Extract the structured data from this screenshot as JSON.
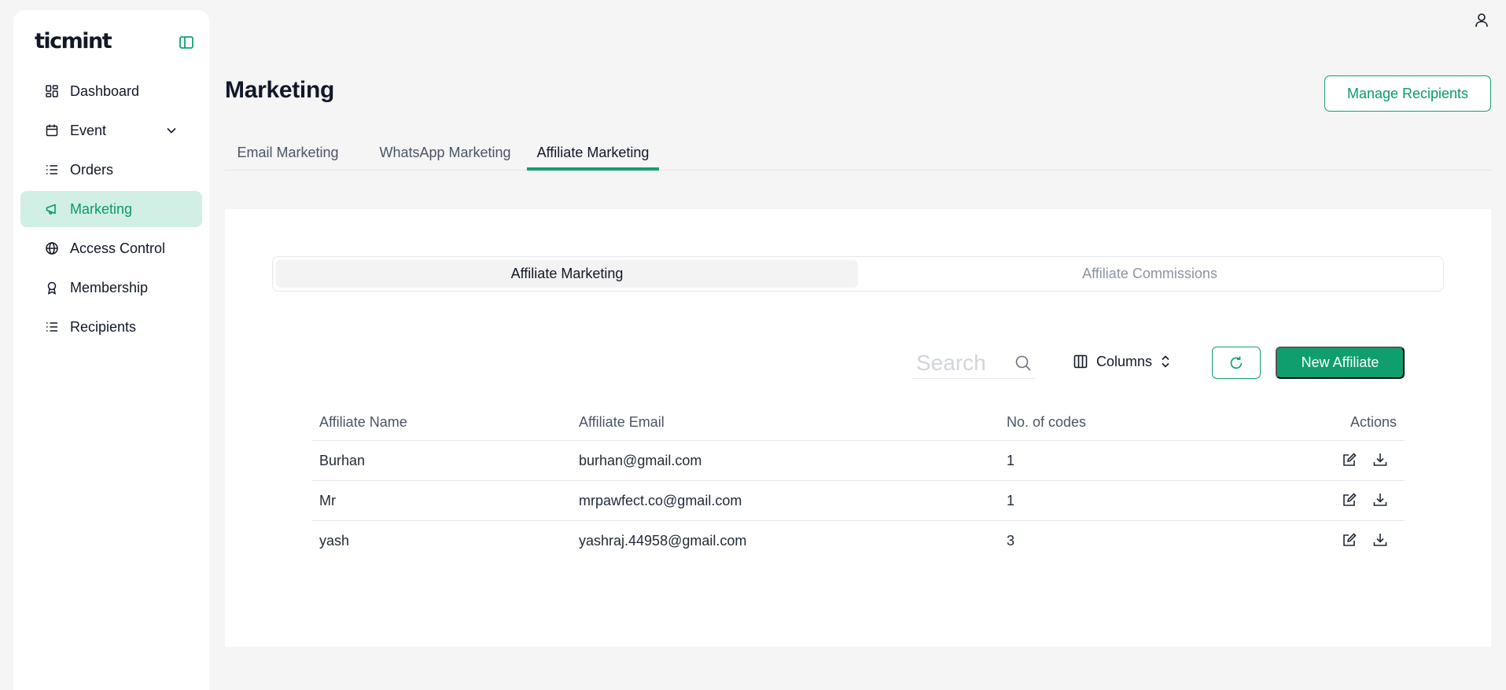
{
  "brand": {
    "name": "ticmint"
  },
  "sidebar": {
    "items": [
      {
        "label": "Dashboard",
        "icon": "dashboard-icon"
      },
      {
        "label": "Event",
        "icon": "calendar-icon",
        "has_chevron": true
      },
      {
        "label": "Orders",
        "icon": "orders-list-icon"
      },
      {
        "label": "Marketing",
        "icon": "megaphone-icon",
        "active": true
      },
      {
        "label": "Access Control",
        "icon": "globe-icon"
      },
      {
        "label": "Membership",
        "icon": "badge-icon"
      },
      {
        "label": "Recipients",
        "icon": "list-icon"
      }
    ]
  },
  "header": {
    "title": "Marketing",
    "manage_recipients_label": "Manage Recipients"
  },
  "tabs": [
    {
      "label": "Email Marketing"
    },
    {
      "label": "WhatsApp Marketing"
    },
    {
      "label": "Affiliate Marketing",
      "active": true
    }
  ],
  "segmented": {
    "active_label": "Affiliate Marketing",
    "inactive_label": "Affiliate Commissions"
  },
  "toolbar": {
    "search_placeholder": "Search",
    "columns_label": "Columns",
    "new_affiliate_label": "New Affiliate"
  },
  "table": {
    "headers": [
      "Affiliate Name",
      "Affiliate Email",
      "No. of codes",
      "Actions"
    ],
    "rows": [
      {
        "name": "Burhan",
        "email": "burhan@gmail.com",
        "codes": "1"
      },
      {
        "name": "Mr",
        "email": "mrpawfect.co@gmail.com",
        "codes": "1"
      },
      {
        "name": "yash",
        "email": "yashraj.44958@gmail.com",
        "codes": "3"
      }
    ]
  },
  "colors": {
    "accent": "#0f9f6e",
    "active_nav_bg": "#d1efe4",
    "page_bg": "#f5f5f5"
  }
}
